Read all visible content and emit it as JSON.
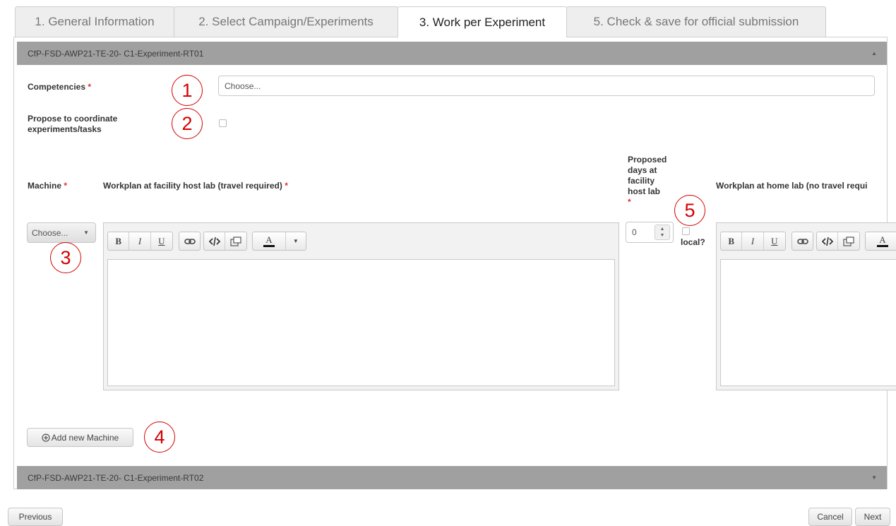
{
  "tabs": [
    {
      "label": "1. General Information"
    },
    {
      "label": "2. Select Campaign/Experiments"
    },
    {
      "label": "3. Work per Experiment"
    },
    {
      "label": "5. Check & save for official submission"
    }
  ],
  "experiment1": {
    "title": "CfP-FSD-AWP21-TE-20- C1-Experiment-RT01",
    "competencies_label": "Competencies",
    "competencies_placeholder": "Choose...",
    "coordinate_label": "Propose to coordinate experiments/tasks",
    "machine_header": "Machine",
    "workplan_facility_header": "Workplan at facility host lab (travel required)",
    "proposed_days_header": "Proposed days at facility host lab",
    "workplan_home_header": "Workplan at home lab (no travel requi",
    "machine_select": "Choose...",
    "days_value": "0",
    "local_label": "local?",
    "add_machine_label": "Add new Machine"
  },
  "experiment2": {
    "title": "CfP-FSD-AWP21-TE-20- C1-Experiment-RT02"
  },
  "required_marker": "*",
  "editor_toolbar": {
    "bold": "B",
    "italic": "I",
    "underline": "U",
    "color": "A"
  },
  "annotations": [
    "1",
    "2",
    "3",
    "4",
    "5"
  ],
  "footer": {
    "previous": "Previous",
    "cancel": "Cancel",
    "next": "Next"
  },
  "colors": {
    "accordion_bar": "#a0a0a0",
    "annotation": "#d40000",
    "required": "#dd3333"
  }
}
